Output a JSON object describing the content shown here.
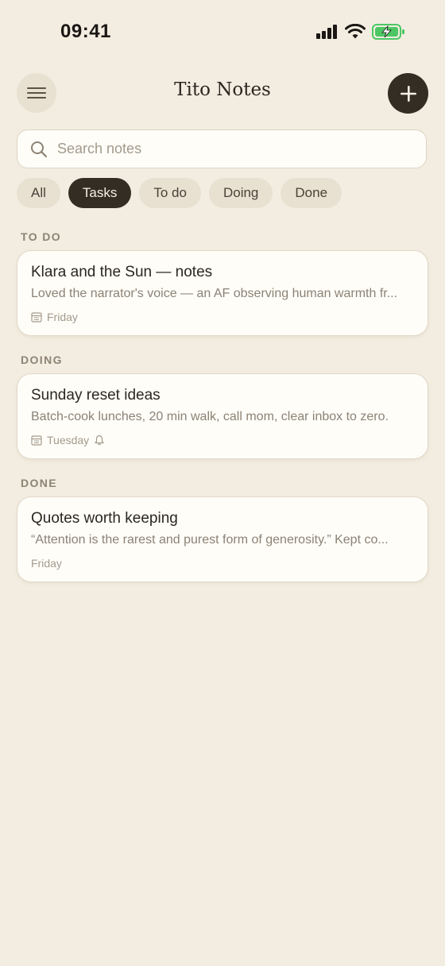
{
  "status": {
    "time": "09:41"
  },
  "header": {
    "title": "Tito Notes"
  },
  "search": {
    "placeholder": "Search notes"
  },
  "filters": [
    "All",
    "Tasks",
    "To do",
    "Doing",
    "Done"
  ],
  "active_filter": "Tasks",
  "sections": [
    {
      "label": "TO DO",
      "note": {
        "title": "Klara and the Sun — notes",
        "preview": "Loved the narrator's voice — an AF observing human warmth fr...",
        "date": "Friday",
        "icons": [
          "calendar-icon"
        ]
      }
    },
    {
      "label": "DOING",
      "note": {
        "title": "Sunday reset ideas",
        "preview": "Batch-cook lunches, 20 min walk, call mom, clear inbox to zero.",
        "date": "Tuesday",
        "icons": [
          "calendar-icon",
          "bell-icon"
        ]
      }
    },
    {
      "label": "DONE",
      "note": {
        "title": "Quotes worth keeping",
        "preview": "“Attention is the rarest and purest form of generosity.” Kept co...",
        "date": "Friday",
        "icons": []
      }
    }
  ],
  "colors": {
    "background": "#f3ede1",
    "accent": "#332d24",
    "battery": "#4cc764"
  }
}
